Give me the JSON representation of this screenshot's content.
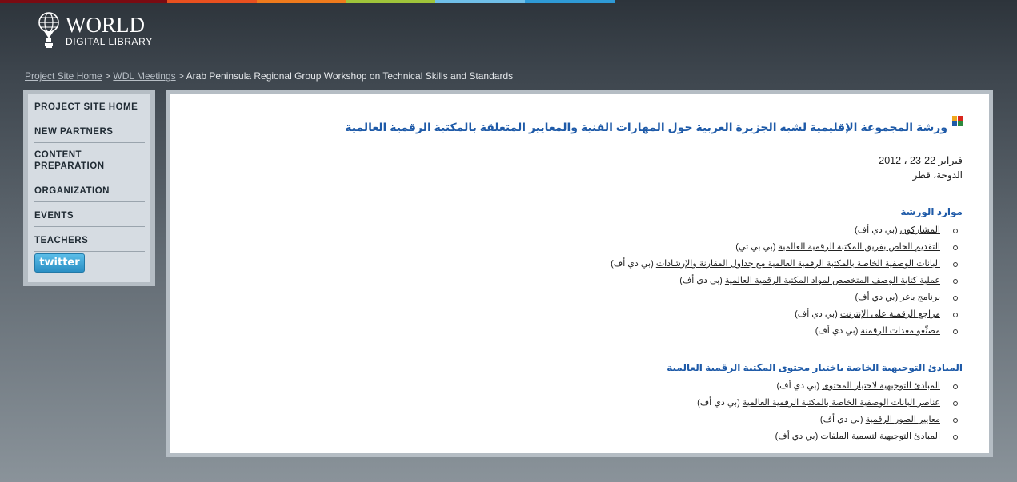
{
  "header": {
    "logo_primary": "WORLD",
    "logo_secondary": "DIGITAL LIBRARY",
    "color_bar": [
      "#7a0b12",
      "#e8501f",
      "#ee7a1c",
      "#9fc43a",
      "#6fbfe8",
      "#2e9ad6"
    ]
  },
  "breadcrumb": {
    "home": "Project Site Home",
    "sep1": " > ",
    "meetings": "WDL Meetings",
    "sep2": " > ",
    "current": "Arab Peninsula Regional Group Workshop on Technical Skills and Standards"
  },
  "sidebar": {
    "items": [
      {
        "label": "PROJECT SITE HOME"
      },
      {
        "label": "NEW PARTNERS"
      },
      {
        "label": "CONTENT PREPARATION"
      },
      {
        "label": "ORGANIZATION"
      },
      {
        "label": "EVENTS"
      },
      {
        "label": "TEACHERS"
      }
    ],
    "twitter_label": "twitter"
  },
  "main": {
    "title": "ورشة المجموعة الإقليمية لشبه الجزيرة العربية حول المهارات الفنية والمعايير المتعلقة بالمكتبة الرقمية العالمية",
    "date": "فبراير 22-23 ، 2012",
    "place": "الدوحة، قطر",
    "section1": {
      "heading": "موارد الورشة",
      "items": [
        {
          "link": "المشاركون",
          "suffix": " (بي دي أف)"
        },
        {
          "link": "التقديم الخاص بفريق المكتبة الرقمية العالمية",
          "suffix": " (بي بي تي)"
        },
        {
          "link": "البانات الوصفية الخاصة بالمكتبة الرقمية العالمية مع جداول المقارنة والإرشادات",
          "suffix": " (بي دي أف)"
        },
        {
          "link": "عملية كتابة الوصف المتخصص لمواد المكتبة الرقمية العالمية",
          "suffix": " (بي دي أف)"
        },
        {
          "link": "برنامج باغر",
          "suffix": " (بي دي أف)"
        },
        {
          "link": "مراجع الرقمنة على الإنترنت",
          "suffix": " (بي دي أف)"
        },
        {
          "link": "مصنِّعو معدات الرقمنة",
          "suffix": " (بي دي أف)"
        }
      ]
    },
    "section2": {
      "heading": "المبادئ التوجيهية الخاصة باختيار محتوى المكتبة الرقمية العالمية",
      "items": [
        {
          "link": "المبادئ التوجيهية لاختيار المحتوى",
          "suffix": " (بي دي أف)"
        },
        {
          "link": "عناصر البانات الوصفية الخاصة بالمكتبة الرقمية العالمية",
          "suffix": " (بي دي أف)"
        },
        {
          "link": "معايير الصور الرقمية",
          "suffix": " (بي دي أف)"
        },
        {
          "link": "المبادئ التوجيهية لتسمية الملفات",
          "suffix": " (بي دي أف)"
        }
      ]
    },
    "title_icon_colors": [
      "#d9261c",
      "#f0a81c",
      "#2e8a3e",
      "#1e5aa8"
    ]
  }
}
